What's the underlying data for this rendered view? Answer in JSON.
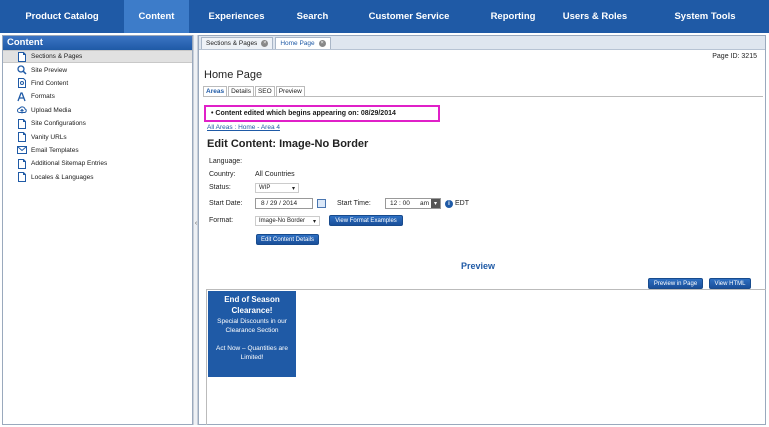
{
  "nav": {
    "items": [
      "Product Catalog",
      "Content",
      "Experiences",
      "Search",
      "Customer Service",
      "Reporting",
      "Users & Roles",
      "System Tools"
    ],
    "active_index": 1
  },
  "sidebar": {
    "title": "Content",
    "items": [
      {
        "label": "Sections & Pages",
        "icon": "page-icon"
      },
      {
        "label": "Site Preview",
        "icon": "magnifier-icon"
      },
      {
        "label": "Find Content",
        "icon": "find-page-icon"
      },
      {
        "label": "Formats",
        "icon": "formats-icon"
      },
      {
        "label": "Upload Media",
        "icon": "upload-icon"
      },
      {
        "label": "Site Configurations",
        "icon": "page-icon"
      },
      {
        "label": "Vanity URLs",
        "icon": "page-icon"
      },
      {
        "label": "Email Templates",
        "icon": "envelope-icon"
      },
      {
        "label": "Additional Sitemap Entries",
        "icon": "page-icon"
      },
      {
        "label": "Locales & Languages",
        "icon": "page-icon"
      }
    ]
  },
  "tabs": {
    "items": [
      {
        "label": "Sections & Pages"
      },
      {
        "label": "Home Page"
      }
    ]
  },
  "page": {
    "id_text": "Page ID: 3215",
    "title": "Home Page",
    "subtabs": [
      "Areas",
      "Details",
      "SEO",
      "Preview"
    ]
  },
  "alert": "• Content edited which begins appearing on: 08/29/2014",
  "breadcrumb": "All Areas : Home - Area 4",
  "edit": {
    "title": "Edit Content: Image-No Border",
    "language_label": "Language:",
    "country_label": "Country:",
    "country_value": "All Countries",
    "status_label": "Status:",
    "status_value": "WIP",
    "start_date_label": "Start Date:",
    "start_date_value": "8  /  29  /  2014",
    "start_time_label": "Start Time:",
    "start_time_value": "12 : 00",
    "ampm_value": "am",
    "timezone": "EDT",
    "format_label": "Format:",
    "format_value": "Image-No Border",
    "view_format_examples": "View Format Examples",
    "edit_content_details": "Edit Content Details"
  },
  "preview": {
    "label": "Preview",
    "preview_in_page": "Preview in Page",
    "view_html": "View HTML",
    "promo_title": "End of Season Clearance!",
    "promo_sub": "Special Discounts in our Clearance Section",
    "promo_cta": "Act Now – Quantities are Limited!"
  },
  "colors": {
    "nav_bg": "#1f5aa6",
    "nav_active": "#3d7cc9",
    "alert_border": "#e020c8",
    "link": "#1f5aa6"
  }
}
